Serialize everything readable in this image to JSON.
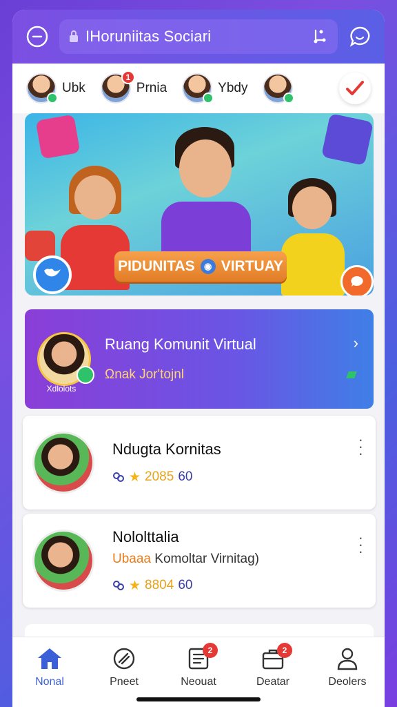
{
  "header": {
    "search_text": "IHoruniitas Sociari",
    "left_icon": "menu-circle-icon",
    "right_icons": [
      "share-icon",
      "chat-bubble-icon"
    ]
  },
  "stories": [
    {
      "name": "Ubk",
      "status": "online",
      "notification": ""
    },
    {
      "name": "Prnia",
      "status": "",
      "notification": "1"
    },
    {
      "name": "Ybdy",
      "status": "online",
      "notification": ""
    },
    {
      "name": "",
      "status": "online",
      "notification": ""
    }
  ],
  "hero": {
    "banner_left": "PIDUNITAS",
    "banner_right": "VIRTUAY"
  },
  "room": {
    "title": "Ruang Komunit Virtual",
    "subtitle": "Ωnak Jor'tojnl",
    "avatar_label": "Xdlolots"
  },
  "cards": [
    {
      "title": "Ndugta Kornitas",
      "subtitle_accent": "",
      "subtitle": "",
      "stat1": "2085",
      "stat2": "60"
    },
    {
      "title": "Nololttalia",
      "subtitle_accent": "Ubaaa",
      "subtitle": "Komoltar Virnitag)",
      "stat1": "8804",
      "stat2": "60"
    }
  ],
  "nav": [
    {
      "label": "Nonal",
      "icon": "home-icon",
      "badge": "",
      "active": true
    },
    {
      "label": "Pneet",
      "icon": "tag-icon",
      "badge": "",
      "active": false
    },
    {
      "label": "Neouat",
      "icon": "document-icon",
      "badge": "2",
      "active": false
    },
    {
      "label": "Deatar",
      "icon": "bag-icon",
      "badge": "2",
      "active": false
    },
    {
      "label": "Deolers",
      "icon": "user-icon",
      "badge": "",
      "active": false
    }
  ],
  "colors": {
    "accent": "#3b5fd6",
    "header": "#7c4fe3",
    "badge": "#e53935",
    "online": "#2ec26a",
    "star": "#f5c542"
  }
}
